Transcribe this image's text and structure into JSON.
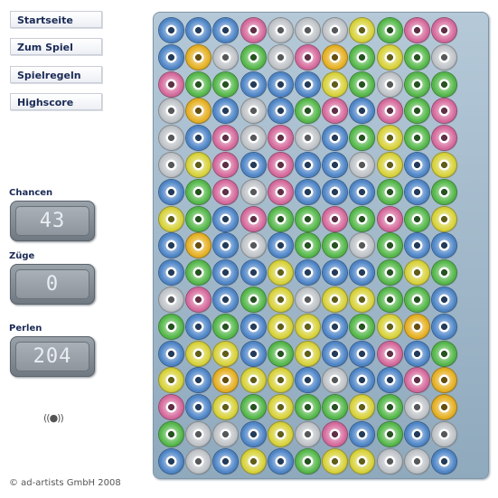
{
  "nav": {
    "items": [
      {
        "label": "Startseite"
      },
      {
        "label": "Zum Spiel"
      },
      {
        "label": "Spielregeln"
      },
      {
        "label": "Highscore"
      }
    ]
  },
  "stats": {
    "chancen_label": "Chancen",
    "chancen_value": "43",
    "zuege_label": "Züge",
    "zuege_value": "0",
    "perlen_label": "Perlen",
    "perlen_value": "204"
  },
  "sound_icon": "sound-toggle-icon",
  "footer": {
    "copyright": "© ad-artists GmbH 2008"
  },
  "colors": {
    "b": "#4f86c8",
    "o": "#e6b022",
    "g": "#55b84a",
    "p": "#d66a9c",
    "w": "#bfc3c7",
    "y": "#d8d23a"
  },
  "board": {
    "rows": [
      "bbbpwwwygpp",
      "bowgwpogygw",
      "pggbbbygwgg",
      "wobwbgpbpgp",
      "wbpwpwbgygp",
      "wypbpbbwyby",
      "bgpwpbbbgbg",
      "ygbpggpgpgy",
      "bobwbggwgbb",
      "bgbbybbbgyg",
      "wpbgywyyggb",
      "gbgbyybgyob",
      "byybgybbpbg",
      "yboyybwbbpo",
      "pbygyggygwo",
      "gwwbywpbgbw",
      "bwbybgyywwb"
    ]
  }
}
